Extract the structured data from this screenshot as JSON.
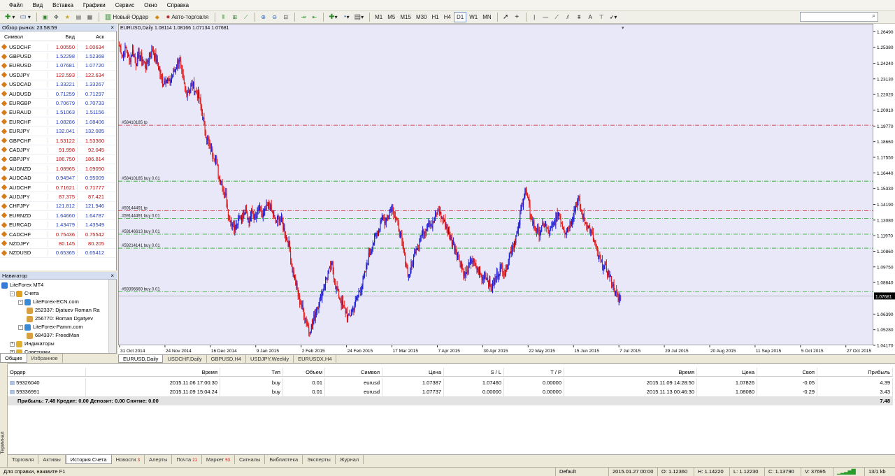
{
  "menu": [
    "Файл",
    "Вид",
    "Вставка",
    "Графики",
    "Сервис",
    "Окно",
    "Справка"
  ],
  "toolbar": {
    "new_order": "Новый Ордер",
    "auto_trading": "Авто-торговля",
    "timeframes": [
      "M1",
      "M5",
      "M15",
      "M30",
      "H1",
      "H4",
      "D1",
      "W1",
      "MN"
    ],
    "active_timeframe": "D1",
    "text_tool": "A",
    "search_placeholder": ""
  },
  "market_watch": {
    "title": "Обзор рынка: 23:58:59",
    "headers": {
      "symbol": "Символ",
      "bid": "Бид",
      "ask": "Аск"
    },
    "rows": [
      {
        "s": "USDCHF",
        "b": "1.00550",
        "a": "1.00634",
        "c": "#d40000"
      },
      {
        "s": "GBPUSD",
        "b": "1.52298",
        "a": "1.52368",
        "c": "#1a3cd0"
      },
      {
        "s": "EURUSD",
        "b": "1.07681",
        "a": "1.07720",
        "c": "#1a3cd0"
      },
      {
        "s": "USDJPY",
        "b": "122.593",
        "a": "122.634",
        "c": "#d40000"
      },
      {
        "s": "USDCAD",
        "b": "1.33221",
        "a": "1.33267",
        "c": "#1a3cd0"
      },
      {
        "s": "AUDUSD",
        "b": "0.71259",
        "a": "0.71297",
        "c": "#1a3cd0"
      },
      {
        "s": "EURGBP",
        "b": "0.70679",
        "a": "0.70733",
        "c": "#1a3cd0"
      },
      {
        "s": "EURAUD",
        "b": "1.51063",
        "a": "1.51156",
        "c": "#1a3cd0"
      },
      {
        "s": "EURCHF",
        "b": "1.08286",
        "a": "1.08406",
        "c": "#1a3cd0"
      },
      {
        "s": "EURJPY",
        "b": "132.041",
        "a": "132.085",
        "c": "#1a3cd0"
      },
      {
        "s": "GBPCHF",
        "b": "1.53122",
        "a": "1.53360",
        "c": "#d40000"
      },
      {
        "s": "CADJPY",
        "b": "91.998",
        "a": "92.045",
        "c": "#d40000"
      },
      {
        "s": "GBPJPY",
        "b": "186.750",
        "a": "186.814",
        "c": "#d40000"
      },
      {
        "s": "AUDNZD",
        "b": "1.08965",
        "a": "1.09050",
        "c": "#d40000"
      },
      {
        "s": "AUDCAD",
        "b": "0.94947",
        "a": "0.95009",
        "c": "#1a3cd0"
      },
      {
        "s": "AUDCHF",
        "b": "0.71621",
        "a": "0.71777",
        "c": "#d40000"
      },
      {
        "s": "AUDJPY",
        "b": "87.375",
        "a": "87.421",
        "c": "#d40000"
      },
      {
        "s": "CHFJPY",
        "b": "121.812",
        "a": "121.946",
        "c": "#1a3cd0"
      },
      {
        "s": "EURNZD",
        "b": "1.64660",
        "a": "1.64787",
        "c": "#1a3cd0"
      },
      {
        "s": "EURCAD",
        "b": "1.43479",
        "a": "1.43549",
        "c": "#1a3cd0"
      },
      {
        "s": "CADCHF",
        "b": "0.75436",
        "a": "0.75542",
        "c": "#d40000"
      },
      {
        "s": "NZDJPY",
        "b": "80.145",
        "a": "80.205",
        "c": "#d40000"
      },
      {
        "s": "NZDUSD",
        "b": "0.65365",
        "a": "0.65412",
        "c": "#1a3cd0"
      }
    ],
    "tabs": [
      "Символы",
      "Тиковый график"
    ]
  },
  "navigator": {
    "title": "Навигатор",
    "items": [
      {
        "label": "LiteForex MT4",
        "level": 0,
        "icon": "#3a7bd5",
        "exp": ""
      },
      {
        "label": "Счета",
        "level": 1,
        "icon": "#e0a020",
        "exp": "-"
      },
      {
        "label": "LiteForex-ECN.com",
        "level": 2,
        "icon": "#3a8ad5",
        "exp": "-"
      },
      {
        "label": "252337: Djatuev Roman Ra",
        "level": 3,
        "icon": "#d8a040",
        "exp": ""
      },
      {
        "label": "256770: Roman Dgatyev",
        "level": 3,
        "icon": "#d8a040",
        "exp": ""
      },
      {
        "label": "LiteForex-Pamm.com",
        "level": 2,
        "icon": "#3a8ad5",
        "exp": "-"
      },
      {
        "label": "684337: FreedMan",
        "level": 3,
        "icon": "#d8a040",
        "exp": ""
      },
      {
        "label": "Индикаторы",
        "level": 1,
        "icon": "#e0b030",
        "exp": "+"
      },
      {
        "label": "Советники",
        "level": 1,
        "icon": "#e0b030",
        "exp": "+"
      }
    ],
    "tabs": [
      "Общие",
      "Избранное"
    ]
  },
  "chart": {
    "label": "EURUSD,Daily  1.08114 1.08166 1.07134 1.07681",
    "current_price": "1.07681",
    "tabs": [
      "EURUSD,Daily",
      "USDCHF,Daily",
      "GBPUSD,H4",
      "USDJPY,Weekly",
      "EURUSDX,H4"
    ],
    "order_lines": [
      {
        "label": "#58410185 tp",
        "price": 1.1983,
        "color": "#cc2222"
      },
      {
        "label": "#58410185 buy 0.01",
        "price": 1.1585,
        "color": "#22aa22"
      },
      {
        "label": "#59144491 tp",
        "price": 1.1375,
        "color": "#cc2222"
      },
      {
        "label": "#59144491 buy 0.01",
        "price": 1.1319,
        "color": "#22aa22"
      },
      {
        "label": "#59146613 buy 0.01",
        "price": 1.1208,
        "color": "#22aa22"
      },
      {
        "label": "#59214141 buy 0.01",
        "price": 1.1108,
        "color": "#22aa22"
      },
      {
        "label": "#59396669 buy 0.01",
        "price": 1.0797,
        "color": "#22aa22"
      }
    ]
  },
  "chart_data": {
    "type": "candlestick",
    "symbol": "EURUSD",
    "timeframe": "Daily",
    "y_ticks": [
      "1.26490",
      "1.25380",
      "1.24240",
      "1.23130",
      "1.22020",
      "1.20910",
      "1.19770",
      "1.18660",
      "1.17550",
      "1.16440",
      "1.15330",
      "1.14190",
      "1.13080",
      "1.11970",
      "1.10860",
      "1.09750",
      "1.08640",
      "1.07681",
      "1.06390",
      "1.05280",
      "1.04170"
    ],
    "x_ticks": [
      "31 Oct 2014",
      "24 Nov 2014",
      "16 Dec 2014",
      "9 Jan 2015",
      "2 Feb 2015",
      "24 Feb 2015",
      "17 Mar 2015",
      "7 Apr 2015",
      "30 Apr 2015",
      "22 May 2015",
      "15 Jun 2015",
      "7 Jul 2015",
      "29 Jul 2015",
      "20 Aug 2015",
      "11 Sep 2015",
      "5 Oct 2015",
      "27 Oct 2015"
    ],
    "ylim": [
      1.0417,
      1.2705
    ],
    "path": [
      1.255,
      1.248,
      1.253,
      1.244,
      1.251,
      1.243,
      1.249,
      1.245,
      1.24,
      1.247,
      1.252,
      1.245,
      1.238,
      1.228,
      1.232,
      1.228,
      1.234,
      1.24,
      1.246,
      1.232,
      1.222,
      1.223,
      1.228,
      1.222,
      1.218,
      1.205,
      1.192,
      1.184,
      1.178,
      1.176,
      1.16,
      1.155,
      1.148,
      1.133,
      1.128,
      1.125,
      1.131,
      1.134,
      1.14,
      1.129,
      1.137,
      1.131,
      1.139,
      1.133,
      1.138,
      1.142,
      1.136,
      1.129,
      1.133,
      1.128,
      1.12,
      1.113,
      1.096,
      1.086,
      1.075,
      1.068,
      1.061,
      1.052,
      1.056,
      1.066,
      1.072,
      1.08,
      1.088,
      1.094,
      1.099,
      1.084,
      1.077,
      1.071,
      1.066,
      1.061,
      1.066,
      1.072,
      1.079,
      1.085,
      1.094,
      1.105,
      1.112,
      1.119,
      1.124,
      1.134,
      1.129,
      1.137,
      1.141,
      1.132,
      1.125,
      1.114,
      1.102,
      1.091,
      1.098,
      1.11,
      1.115,
      1.121,
      1.124,
      1.131,
      1.126,
      1.133,
      1.138,
      1.132,
      1.128,
      1.121,
      1.116,
      1.111,
      1.104,
      1.097,
      1.091,
      1.097,
      1.103,
      1.098,
      1.094,
      1.089,
      1.092,
      1.087,
      1.082,
      1.089,
      1.094,
      1.098,
      1.093,
      1.104,
      1.111,
      1.117,
      1.124,
      1.142,
      1.153,
      1.143,
      1.13,
      1.126,
      1.121,
      1.125,
      1.128,
      1.121,
      1.125,
      1.13,
      1.136,
      1.129,
      1.123,
      1.126,
      1.131,
      1.139,
      1.146,
      1.136,
      1.13,
      1.126,
      1.121,
      1.114,
      1.105,
      1.099,
      1.097,
      1.093,
      1.087,
      1.08,
      1.074,
      1.077
    ]
  },
  "terminal": {
    "side_label": "Терминал",
    "headers": [
      "Ордер",
      "Время",
      "Тип",
      "Объем",
      "Символ",
      "Цена",
      "S / L",
      "T / P",
      "Время",
      "Цена",
      "Своп",
      "Прибыль"
    ],
    "rows": [
      [
        "59326040",
        "2015.11.06 17:00:30",
        "buy",
        "0.01",
        "eurusd",
        "1.07387",
        "1.07460",
        "0.00000",
        "2015.11.09 14:28:50",
        "1.07826",
        "-0.05",
        "4.39"
      ],
      [
        "59336991",
        "2015.11.09 15:04:24",
        "buy",
        "0.01",
        "eurusd",
        "1.07737",
        "0.00000",
        "0.00000",
        "2015.11.13 00:46:30",
        "1.08080",
        "-0.29",
        "3.43"
      ]
    ],
    "summary": "Прибыль: 7.48  Кредит: 0.00  Депозит: 0.00  Снятие: 0.00",
    "summary_total": "7.48",
    "tabs": [
      {
        "label": "Торговля",
        "count": ""
      },
      {
        "label": "Активы",
        "count": ""
      },
      {
        "label": "История Счета",
        "count": ""
      },
      {
        "label": "Новости",
        "count": "3"
      },
      {
        "label": "Алерты",
        "count": ""
      },
      {
        "label": "Почта",
        "count": "21"
      },
      {
        "label": "Маркет",
        "count": "53"
      },
      {
        "label": "Сигналы",
        "count": ""
      },
      {
        "label": "Библиотека",
        "count": ""
      },
      {
        "label": "Эксперты",
        "count": ""
      },
      {
        "label": "Журнал",
        "count": ""
      }
    ],
    "active_tab": "История Счета"
  },
  "status": {
    "help": "Для справки, нажмите F1",
    "profile": "Default",
    "datetime": "2015.01.27 00:00",
    "open": "O: 1.12360",
    "high": "H: 1.14220",
    "low": "L: 1.12230",
    "close": "C: 1.13790",
    "volume": "V: 37695",
    "traffic": "13/1 kb"
  }
}
